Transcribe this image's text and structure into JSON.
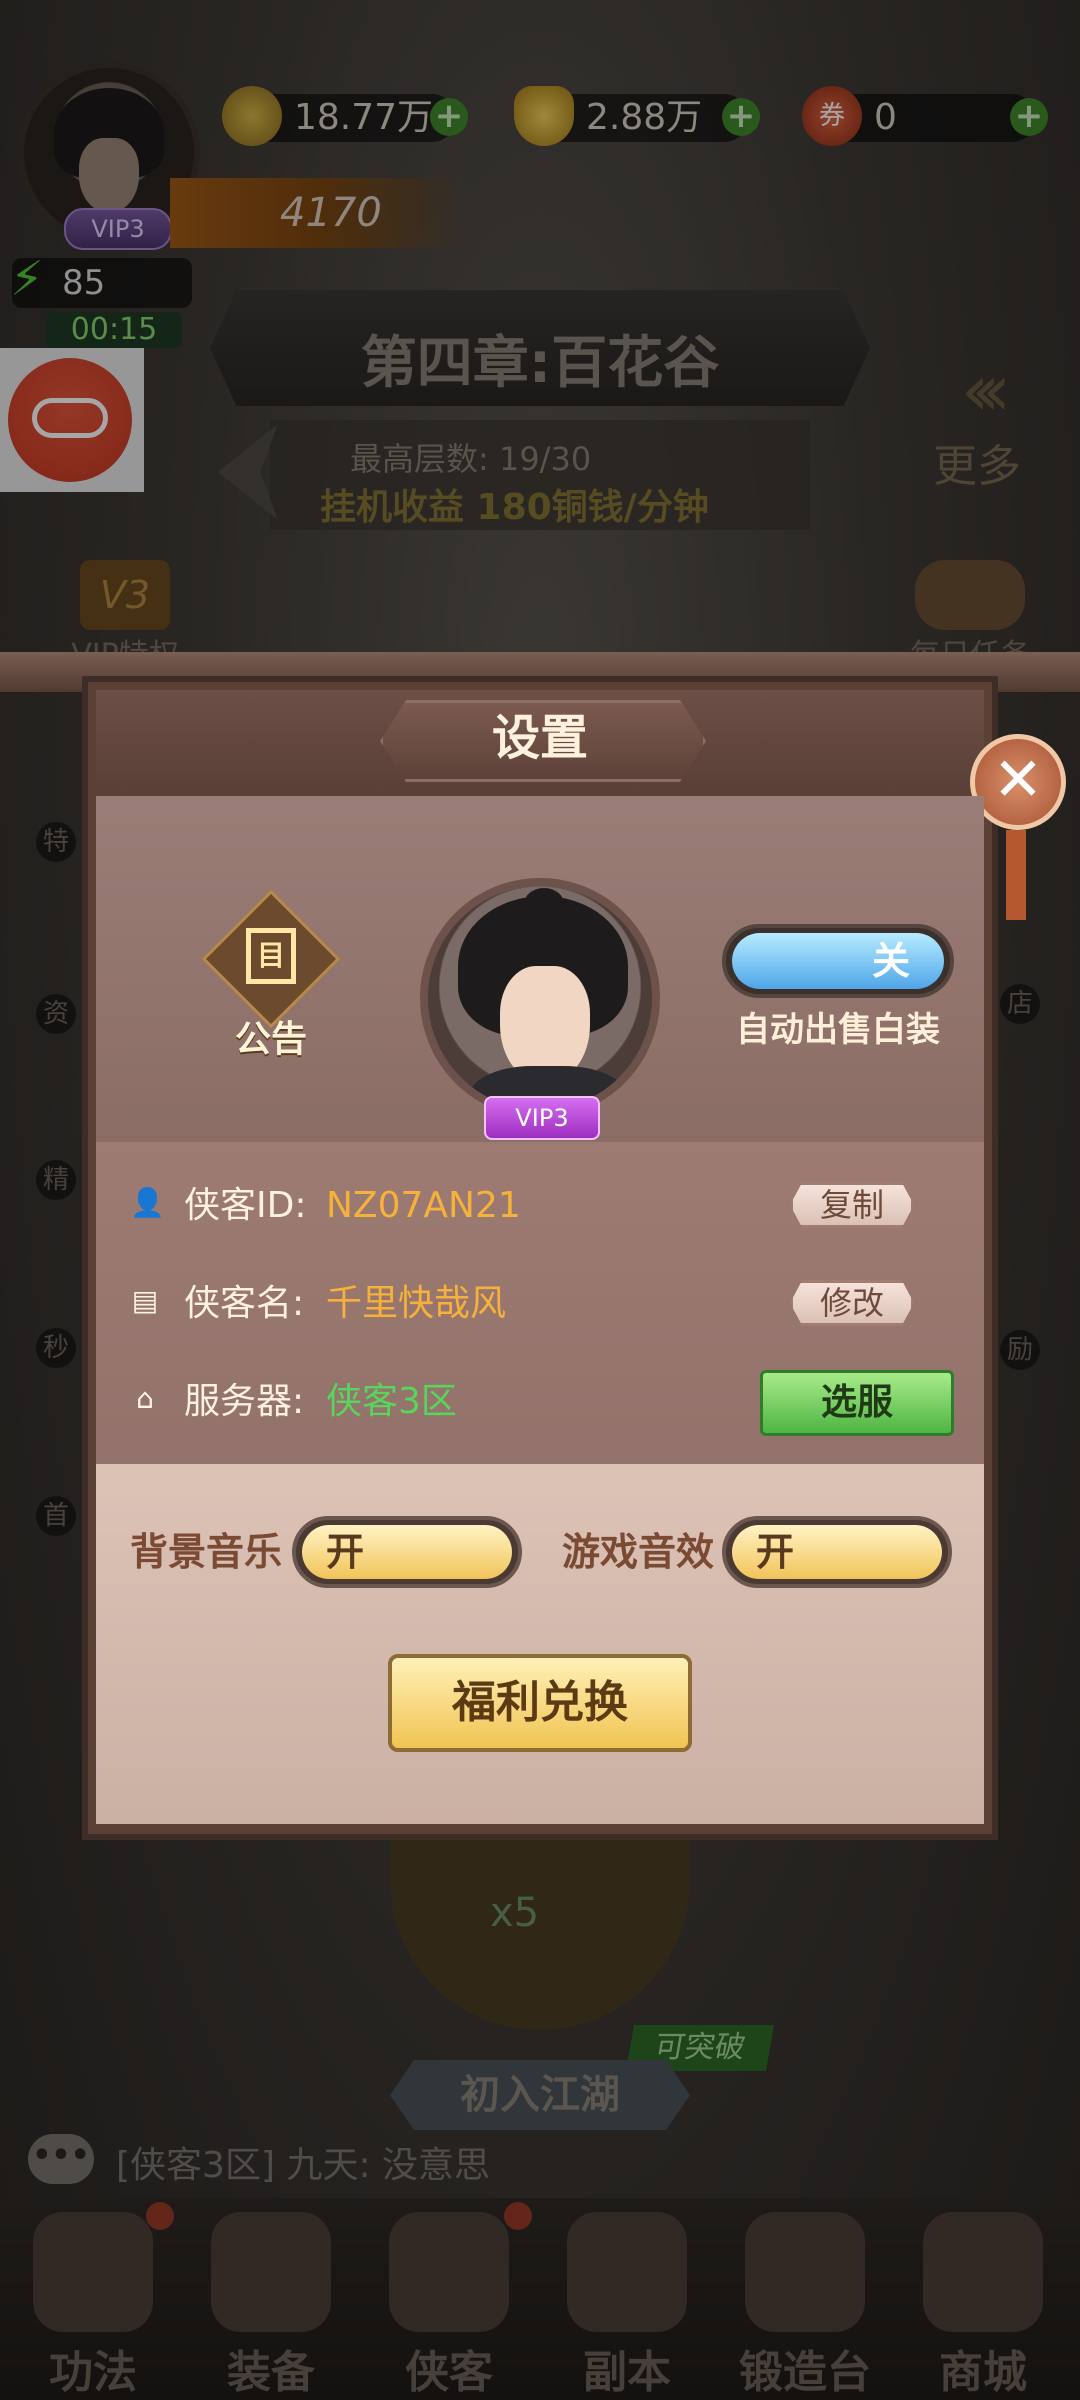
{
  "hud": {
    "vip_badge": "VIP3",
    "copper": "18.77万",
    "gold": "2.88万",
    "tickets": "0",
    "tickets_icon_char": "券",
    "power": "4170",
    "energy": "85",
    "timer": "00:15"
  },
  "stage": {
    "chapter_title": "第四章:百花谷",
    "max_floor": "最高层数: 19/30",
    "idle_income": "挂机收益  180铜钱/分钟",
    "more_label": "更多"
  },
  "side_menu": {
    "vip_badge": "V3",
    "vip_privilege": "VIP特权",
    "daily_tasks": "每日任务",
    "left_items": [
      "特",
      "资",
      "精",
      "秒",
      "首"
    ],
    "right_items": [
      "店",
      "励"
    ]
  },
  "battle": {
    "cost": "x5",
    "enter_label": "初入江湖",
    "breakthrough_tag": "可突破"
  },
  "chat": {
    "icon_text": "•••",
    "message": "[侠客3区]  九天: 没意思"
  },
  "bottom_nav": [
    {
      "label": "功法"
    },
    {
      "label": "装备"
    },
    {
      "label": "侠客"
    },
    {
      "label": "副本"
    },
    {
      "label": "锻造台"
    },
    {
      "label": "商城"
    }
  ],
  "settings": {
    "title": "设置",
    "close_symbol": "✕",
    "notice_label": "公告",
    "notice_glyph": "目",
    "avatar_vip": "VIP3",
    "auto_sell": {
      "state": "关",
      "label": "自动出售白装"
    },
    "player_id": {
      "label": "侠客ID:",
      "value": "NZ07AN21",
      "button": "复制",
      "icon": "person-icon"
    },
    "player_name": {
      "label": "侠客名:",
      "value": "千里快哉风",
      "button": "修改",
      "icon": "book-icon"
    },
    "server": {
      "label": "服务器:",
      "value": "侠客3区",
      "button": "选服",
      "icon": "home-icon"
    },
    "bgm": {
      "label": "背景音乐",
      "state": "开"
    },
    "sfx": {
      "label": "游戏音效",
      "state": "开"
    },
    "welfare_button": "福利兑换"
  },
  "colors": {
    "id_value": "#f5b13a",
    "name_value": "#f5b13a",
    "server_value": "#58d55a",
    "auto_sell_toggle": "#4fa5e8",
    "sound_toggle": "#f1c45a",
    "server_button": "#4fb542"
  }
}
